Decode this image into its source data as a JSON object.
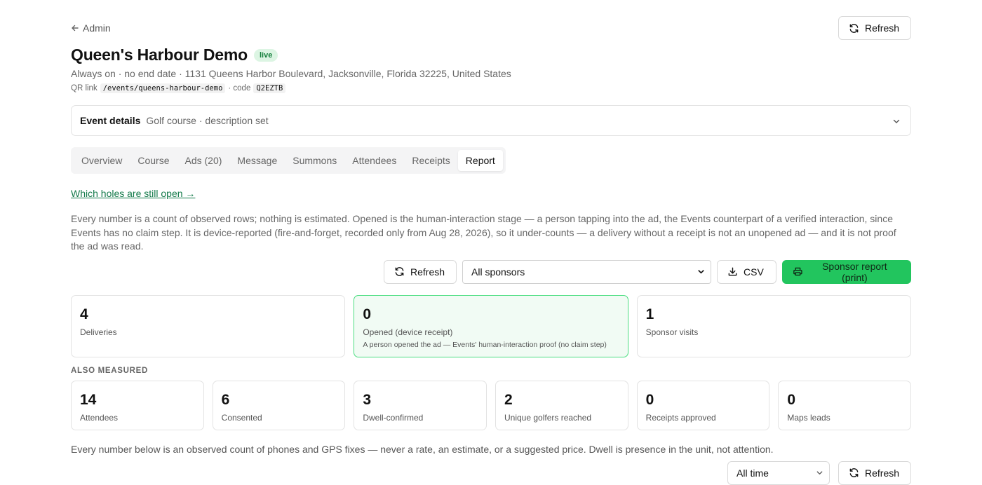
{
  "nav": {
    "back_label": "Admin",
    "refresh_label": "Refresh"
  },
  "event": {
    "title": "Queen's Harbour Demo",
    "status": "live",
    "subtitle": "Always on · no end date · 1131 Queens Harbor Boulevard, Jacksonville, Florida 32225, United States",
    "qr_prefix": "QR link",
    "qr_path": "/events/queens-harbour-demo",
    "code_prefix": "· code",
    "code": "Q2EZTB"
  },
  "details": {
    "label": "Event details",
    "summary": "Golf course · description set"
  },
  "tabs": [
    {
      "label": "Overview"
    },
    {
      "label": "Course"
    },
    {
      "label": "Ads (20)"
    },
    {
      "label": "Message"
    },
    {
      "label": "Summons"
    },
    {
      "label": "Attendees"
    },
    {
      "label": "Receipts"
    },
    {
      "label": "Report"
    }
  ],
  "active_tab": "Report",
  "report": {
    "link": "Which holes are still open →",
    "intro": "Every number is a count of observed rows; nothing is estimated. Opened is the human-interaction stage — a person tapping into the ad, the Events counterpart of a verified interaction, since Events has no claim step. It is device-reported (fire-and-forget, recorded only from Aug 28, 2026), so it under-counts — a delivery without a receipt is not an unopened ad — and it is not proof the ad was read.",
    "toolbar": {
      "refresh": "Refresh",
      "sponsor_select": "All sponsors",
      "csv": "CSV",
      "print": "Sponsor report (print)"
    },
    "primary": [
      {
        "value": "4",
        "label": "Deliveries",
        "note": ""
      },
      {
        "value": "0",
        "label": "Opened (device receipt)",
        "note": "A person opened the ad — Events' human-interaction proof (no claim step)"
      },
      {
        "value": "1",
        "label": "Sponsor visits",
        "note": ""
      }
    ],
    "also_heading": "ALSO MEASURED",
    "secondary": [
      {
        "value": "14",
        "label": "Attendees"
      },
      {
        "value": "6",
        "label": "Consented"
      },
      {
        "value": "3",
        "label": "Dwell-confirmed"
      },
      {
        "value": "2",
        "label": "Unique golfers reached"
      },
      {
        "value": "0",
        "label": "Receipts approved"
      },
      {
        "value": "0",
        "label": "Maps leads"
      }
    ],
    "footer_note": "Every number below is an observed count of phones and GPS fixes — never a rate, an estimate, or a suggested price. Dwell is presence in the unit, not attention.",
    "time_select": "All time",
    "footer_refresh": "Refresh"
  }
}
